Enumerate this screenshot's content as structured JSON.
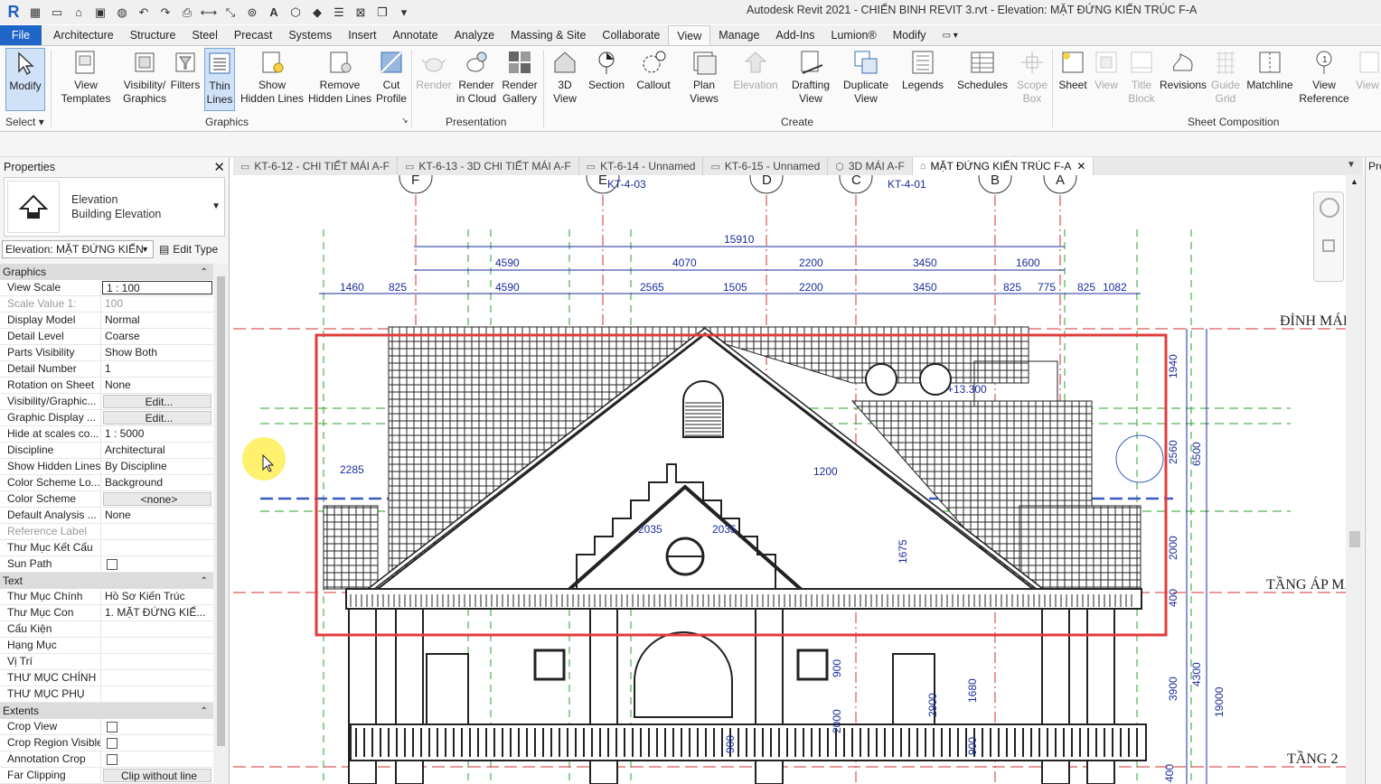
{
  "titlebar": {
    "window_title": "Autodesk Revit 2021 - CHIẾN BINH REVIT 3.rvt - Elevation: MẶT ĐỨNG KIẾN TRÚC F-A"
  },
  "ribbon_tabs": [
    "Architecture",
    "Structure",
    "Steel",
    "Precast",
    "Systems",
    "Insert",
    "Annotate",
    "Analyze",
    "Massing & Site",
    "Collaborate",
    "View",
    "Manage",
    "Add-Ins",
    "Lumion®",
    "Modify"
  ],
  "file_tab": "File",
  "active_tab": "View",
  "ribbon": {
    "select": {
      "modify": "Modify",
      "label": "Select"
    },
    "graphics": {
      "label": "Graphics",
      "view_templates": [
        "View",
        "Templates"
      ],
      "visibility_graphics": [
        "Visibility/",
        "Graphics"
      ],
      "filters": "Filters",
      "thin_lines": [
        "Thin",
        "Lines"
      ],
      "show_hidden": [
        "Show",
        "Hidden Lines"
      ],
      "remove_hidden": [
        "Remove",
        "Hidden Lines"
      ],
      "cut_profile": [
        "Cut",
        "Profile"
      ]
    },
    "presentation": {
      "label": "Presentation",
      "render": "Render",
      "render_cloud": [
        "Render",
        "in Cloud"
      ],
      "render_gallery": [
        "Render",
        "Gallery"
      ]
    },
    "create": {
      "label": "Create",
      "three_d_view": [
        "3D",
        "View"
      ],
      "section": "Section",
      "callout": "Callout",
      "plan_views": [
        "Plan",
        "Views"
      ],
      "elevation": "Elevation",
      "drafting_view": [
        "Drafting",
        "View"
      ],
      "duplicate_view": [
        "Duplicate",
        "View"
      ],
      "legends": "Legends",
      "schedules": "Schedules",
      "scope_box": [
        "Scope",
        "Box"
      ]
    },
    "sheet_composition": {
      "label": "Sheet Composition",
      "sheet": "Sheet",
      "view": "View",
      "title_block": [
        "Title",
        "Block"
      ],
      "revisions": "Revisions",
      "guide_grid": [
        "Guide",
        "Grid"
      ],
      "matchline": "Matchline",
      "view_reference": [
        "View",
        "Reference"
      ],
      "view_more": "View"
    }
  },
  "properties": {
    "title": "Properties",
    "type_family": "Elevation",
    "type_name": "Building Elevation",
    "instance_filter": "Elevation: MẶT ĐỨNG KIẾN",
    "edit_type": "Edit Type",
    "groups": [
      {
        "name": "Graphics",
        "rows": [
          {
            "k": "View Scale",
            "v": "1 : 100",
            "kind": "input"
          },
          {
            "k": "Scale Value    1:",
            "v": "100",
            "kind": "dim"
          },
          {
            "k": "Display Model",
            "v": "Normal"
          },
          {
            "k": "Detail Level",
            "v": "Coarse"
          },
          {
            "k": "Parts Visibility",
            "v": "Show Both"
          },
          {
            "k": "Detail Number",
            "v": "1"
          },
          {
            "k": "Rotation on Sheet",
            "v": "None"
          },
          {
            "k": "Visibility/Graphic...",
            "v": "Edit...",
            "kind": "btn"
          },
          {
            "k": "Graphic Display ...",
            "v": "Edit...",
            "kind": "btn"
          },
          {
            "k": "Hide at scales co...",
            "v": "1 : 5000"
          },
          {
            "k": "Discipline",
            "v": "Architectural"
          },
          {
            "k": "Show Hidden Lines",
            "v": "By Discipline"
          },
          {
            "k": "Color Scheme Lo...",
            "v": "Background"
          },
          {
            "k": "Color Scheme",
            "v": "<none>",
            "kind": "btn"
          },
          {
            "k": "Default Analysis ...",
            "v": "None"
          },
          {
            "k": "Reference Label",
            "v": "",
            "kind": "dim"
          },
          {
            "k": "Thư Mục Kết Cấu",
            "v": ""
          },
          {
            "k": "Sun Path",
            "v": "",
            "kind": "check"
          }
        ]
      },
      {
        "name": "Text",
        "rows": [
          {
            "k": "Thư Mục Chính",
            "v": "Hồ Sơ Kiến Trúc"
          },
          {
            "k": "Thư Mục Con",
            "v": "1. MẶT ĐỨNG KIẾ..."
          },
          {
            "k": "Cấu Kiện",
            "v": ""
          },
          {
            "k": "Hạng Mục",
            "v": ""
          },
          {
            "k": "Vị Trí",
            "v": ""
          },
          {
            "k": "THƯ MỤC CHÍNH",
            "v": ""
          },
          {
            "k": "THƯ MỤC PHỤ",
            "v": ""
          }
        ]
      },
      {
        "name": "Extents",
        "rows": [
          {
            "k": "Crop View",
            "v": "",
            "kind": "check"
          },
          {
            "k": "Crop Region Visible",
            "v": "",
            "kind": "check"
          },
          {
            "k": "Annotation Crop",
            "v": "",
            "kind": "check"
          },
          {
            "k": "Far Clipping",
            "v": "Clip without line",
            "kind": "btn"
          }
        ]
      }
    ]
  },
  "view_tabs": [
    {
      "label": "KT-6-12 - CHI TIẾT MÁI A-F",
      "icon": "sheet-icon"
    },
    {
      "label": "KT-6-13 - 3D CHI TIẾT MÁI A-F",
      "icon": "sheet-icon"
    },
    {
      "label": "KT-6-14 - Unnamed",
      "icon": "sheet-icon"
    },
    {
      "label": "KT-6-15 - Unnamed",
      "icon": "sheet-icon"
    },
    {
      "label": "3D MÁI A-F",
      "icon": "3d-view-icon"
    },
    {
      "label": "MẶT ĐỨNG KIẾN TRÚC F-A",
      "icon": "elevation-icon",
      "active": true
    }
  ],
  "right_tab": "Pro",
  "drawing": {
    "grid_bubbles": [
      "F",
      "E",
      "D",
      "C",
      "B",
      "A"
    ],
    "callout_tags": [
      "KT-4-03",
      "KT-4-01"
    ],
    "dims_row1": [
      "15910"
    ],
    "dims_row2": [
      "4590",
      "4070",
      "2200",
      "3450",
      "1600"
    ],
    "dims_row3": [
      "1460",
      "825",
      "4590",
      "2565",
      "1505",
      "2200",
      "3450",
      "825",
      "775",
      "825",
      "1082"
    ],
    "level_labels": [
      "ĐỈNH MÁI",
      "TẦNG ÁP MÁI",
      "TẦNG 2"
    ],
    "vertical_dims": [
      "1940",
      "2560",
      "6500",
      "2000",
      "400",
      "3900",
      "4300",
      "19000"
    ],
    "misc_dims": [
      "2285",
      "1200",
      "2035",
      "2035",
      "1675",
      "+13.300",
      "900",
      "2000",
      "2900",
      "1680",
      "900",
      "900",
      "400"
    ],
    "highlight_color": "#e23b3b",
    "grid_color": "#d23030",
    "dim_color": "#1a2d9a",
    "level_color": "#2aa02a"
  }
}
